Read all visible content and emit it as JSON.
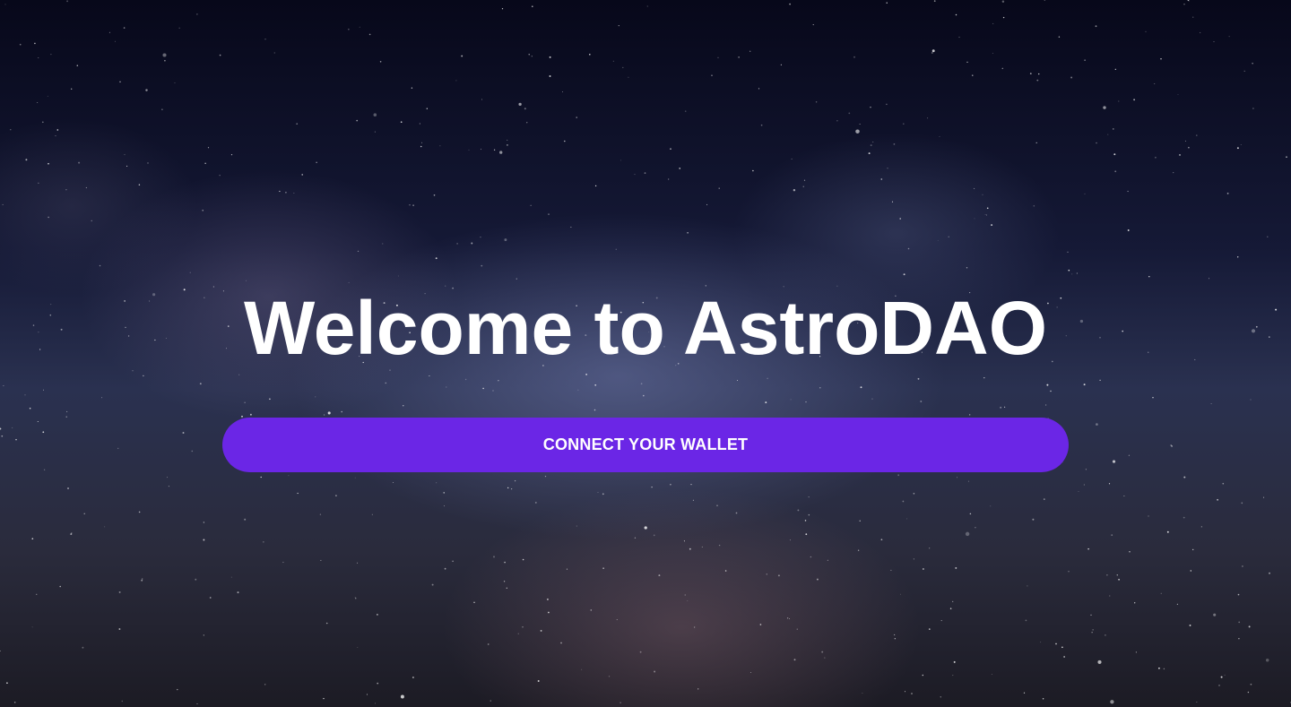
{
  "hero": {
    "title": "Welcome to AstroDAO",
    "connect_button_label": "CONNECT YOUR WALLET"
  },
  "colors": {
    "button_background": "#6b26e6",
    "text": "#ffffff",
    "sky_dark": "#07081a",
    "sky_mid": "#2a3150"
  },
  "background": {
    "image": "starry-night-sky-milky-way"
  }
}
